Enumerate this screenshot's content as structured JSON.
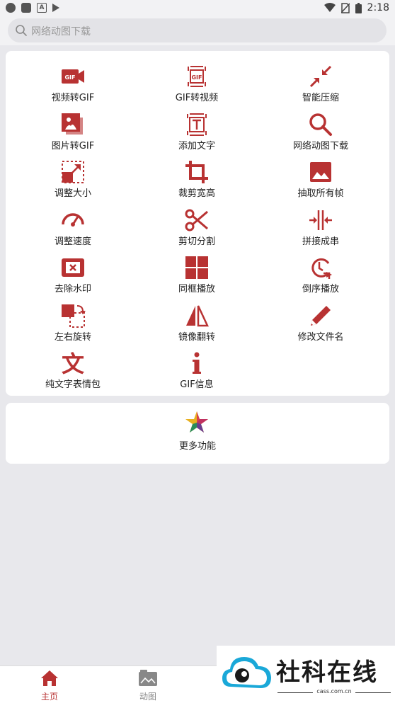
{
  "status_bar": {
    "time": "2:18",
    "icons": [
      "circle-app-icon",
      "square-app-icon",
      "a-app-icon",
      "play-store-icon",
      "wifi-icon",
      "no-sim-icon",
      "battery-icon"
    ]
  },
  "search": {
    "placeholder": "网络动图下载"
  },
  "accent_color": "#b83232",
  "features": [
    {
      "label": "视频转GIF",
      "icon": "video-to-gif-icon"
    },
    {
      "label": "GIF转视频",
      "icon": "gif-to-video-icon"
    },
    {
      "label": "智能压缩",
      "icon": "compress-icon"
    },
    {
      "label": "图片转GIF",
      "icon": "images-to-gif-icon"
    },
    {
      "label": "添加文字",
      "icon": "add-text-icon"
    },
    {
      "label": "网络动图下载",
      "icon": "search-download-icon"
    },
    {
      "label": "调整大小",
      "icon": "resize-icon"
    },
    {
      "label": "裁剪宽高",
      "icon": "crop-icon"
    },
    {
      "label": "抽取所有帧",
      "icon": "image-frames-icon"
    },
    {
      "label": "调整速度",
      "icon": "speedometer-icon"
    },
    {
      "label": "剪切分割",
      "icon": "scissors-icon"
    },
    {
      "label": "拼接成串",
      "icon": "join-icon"
    },
    {
      "label": "去除水印",
      "icon": "remove-watermark-icon"
    },
    {
      "label": "同框播放",
      "icon": "grid-play-icon"
    },
    {
      "label": "倒序播放",
      "icon": "reverse-play-icon"
    },
    {
      "label": "左右旋转",
      "icon": "rotate-icon"
    },
    {
      "label": "镜像翻转",
      "icon": "mirror-flip-icon"
    },
    {
      "label": "修改文件名",
      "icon": "rename-pencil-icon"
    },
    {
      "label": "纯文字表情包",
      "icon": "text-emoji-icon"
    },
    {
      "label": "GIF信息",
      "icon": "info-icon"
    }
  ],
  "more": {
    "label": "更多功能",
    "icon": "colorful-star-icon"
  },
  "bottom_nav": [
    {
      "label": "主页",
      "icon": "home-icon",
      "active": true
    },
    {
      "label": "动图",
      "icon": "gallery-icon",
      "active": false
    }
  ],
  "watermark": {
    "title": "社科在线",
    "subtitle": "cass.com.cn"
  }
}
